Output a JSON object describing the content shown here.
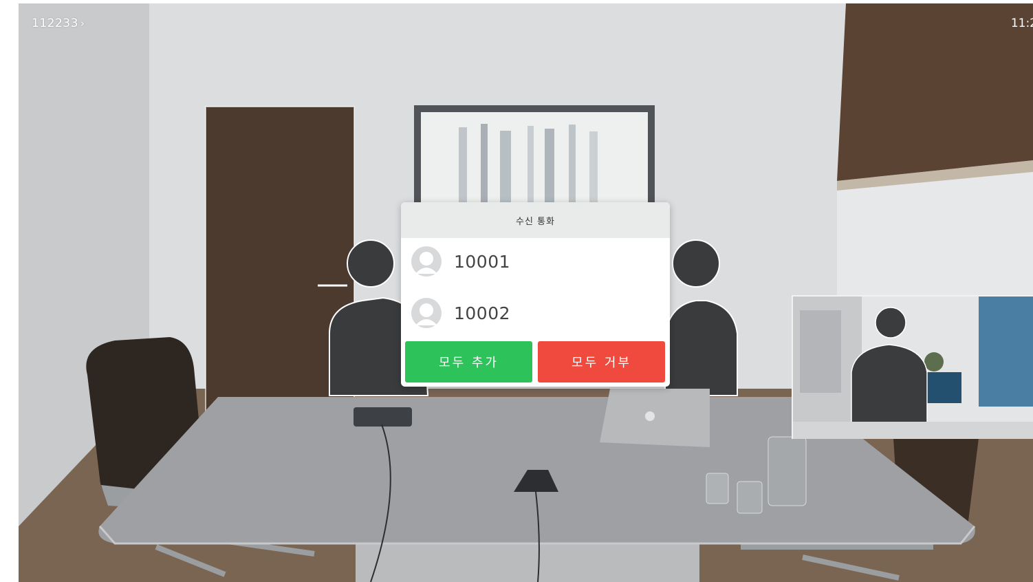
{
  "call_id": "112233",
  "call_id_chevron": "›",
  "clock": "11:2",
  "incoming_dialog": {
    "title": "수신 통화",
    "callers": [
      {
        "number": "10001",
        "icon": "user-avatar-icon"
      },
      {
        "number": "10002",
        "icon": "user-avatar-icon"
      }
    ],
    "accept_all_label": "모두 추가",
    "decline_all_label": "모두 거부"
  },
  "colors": {
    "accept": "#2ec25b",
    "decline": "#f04a3f",
    "dialog_header": "#e9eaea"
  }
}
